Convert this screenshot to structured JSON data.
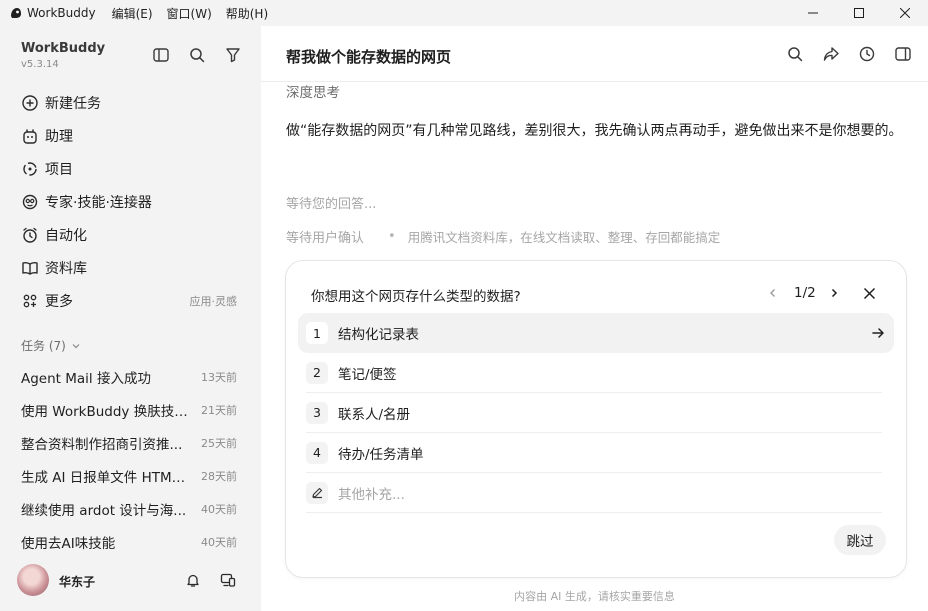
{
  "titlebar": {
    "app_title": "WorkBuddy",
    "menus": [
      "编辑(E)",
      "窗口(W)",
      "帮助(H)"
    ]
  },
  "sidebar": {
    "brand": "WorkBuddy",
    "version": "v5.3.14",
    "nav": [
      {
        "label": "新建任务",
        "icon": "plus-circle-icon"
      },
      {
        "label": "助理",
        "icon": "assistant-icon"
      },
      {
        "label": "项目",
        "icon": "project-icon"
      },
      {
        "label": "专家·技能·连接器",
        "icon": "expert-icon"
      },
      {
        "label": "自动化",
        "icon": "alarm-clock-icon"
      },
      {
        "label": "资料库",
        "icon": "book-icon"
      },
      {
        "label": "更多",
        "icon": "grid-icon",
        "hint": "应用·灵感"
      }
    ],
    "tasks_header": "任务 (7)",
    "tasks": [
      {
        "title": "Agent Mail 接入成功",
        "time": "13天前"
      },
      {
        "title": "使用 WorkBuddy 换肤技能...",
        "time": "21天前"
      },
      {
        "title": "整合资料制作招商引资推...",
        "time": "25天前"
      },
      {
        "title": "生成 AI 日报单文件 HTML ...",
        "time": "28天前"
      },
      {
        "title": "继续使用 ardot 设计与海...",
        "time": "40天前"
      },
      {
        "title": "使用去AI味技能",
        "time": "40天前"
      }
    ],
    "user": {
      "name": "华东子"
    }
  },
  "main": {
    "title": "帮我做个能存数据的网页",
    "thinking": "深度思考",
    "answer": "做“能存数据的网页”有几种常见路线，差别很大，我先确认两点再动手，避免做出来不是你想要的。",
    "waiting": "等待您的回答...",
    "status": "等待用户确认",
    "status_note": "用腾讯文档资料库，在线文档读取、整理、存回都能搞定",
    "question": {
      "text": "你想用这个网页存什么类型的数据?",
      "page": "1/2",
      "options": [
        {
          "num": "1",
          "label": "结构化记录表"
        },
        {
          "num": "2",
          "label": "笔记/便签"
        },
        {
          "num": "3",
          "label": "联系人/名册"
        },
        {
          "num": "4",
          "label": "待办/任务清单"
        }
      ],
      "other_placeholder": "其他补充...",
      "skip": "跳过"
    },
    "disclaimer": "内容由 AI 生成，请核实重要信息"
  }
}
